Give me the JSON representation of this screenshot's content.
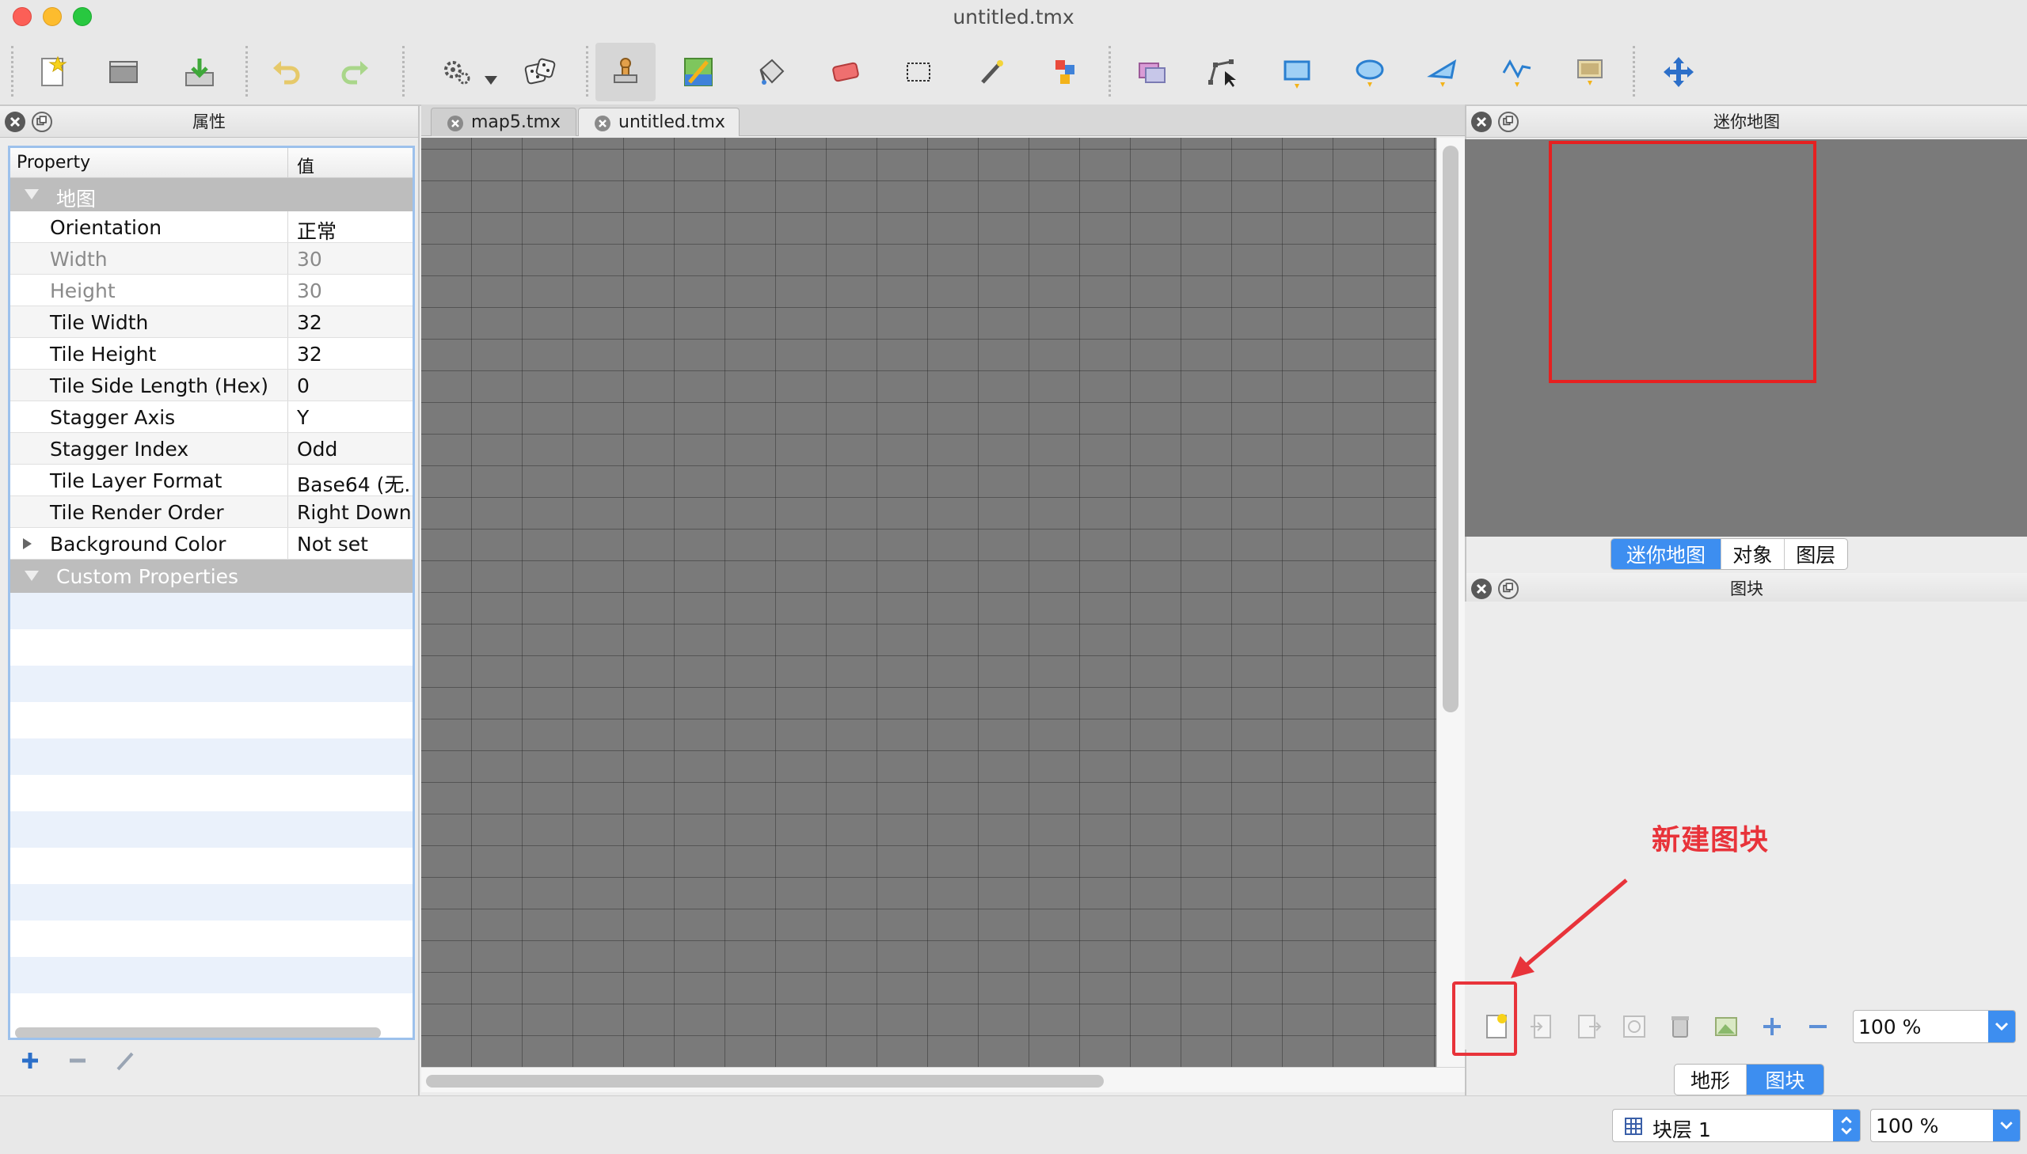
{
  "window": {
    "title": "untitled.tmx"
  },
  "toolbar": {
    "icons": [
      "new-map-icon",
      "open-icon",
      "save-icon",
      "undo-icon",
      "redo-icon",
      "commands-icon",
      "random-mode-icon",
      "stamp-brush-icon",
      "terrain-brush-icon",
      "bucket-fill-icon",
      "eraser-icon",
      "rectangular-select-icon",
      "magic-wand-icon",
      "select-same-tile-icon",
      "select-objects-icon",
      "edit-polygons-icon",
      "insert-rectangle-icon",
      "insert-ellipse-icon",
      "insert-polygon-icon",
      "insert-polyline-icon",
      "insert-tile-icon",
      "move-icon"
    ]
  },
  "properties_panel": {
    "title": "属性",
    "col_property": "Property",
    "col_value": "值",
    "group_map": "地图",
    "rows": [
      {
        "key": "Orientation",
        "value": "正常"
      },
      {
        "key": "Width",
        "value": "30"
      },
      {
        "key": "Height",
        "value": "30"
      },
      {
        "key": "Tile Width",
        "value": "32"
      },
      {
        "key": "Tile Height",
        "value": "32"
      },
      {
        "key": "Tile Side Length (Hex)",
        "value": "0"
      },
      {
        "key": "Stagger Axis",
        "value": "Y"
      },
      {
        "key": "Stagger Index",
        "value": "Odd"
      },
      {
        "key": "Tile Layer Format",
        "value": "Base64 (无..."
      },
      {
        "key": "Tile Render Order",
        "value": "Right Down"
      },
      {
        "key": "Background Color",
        "value": "Not set"
      }
    ],
    "group_custom": "Custom Properties"
  },
  "document_tabs": [
    {
      "label": "map5.tmx"
    },
    {
      "label": "untitled.tmx"
    }
  ],
  "minimap_panel": {
    "title": "迷你地图",
    "tabs": [
      "迷你地图",
      "对象",
      "图层"
    ],
    "active_tab": "迷你地图"
  },
  "tilesets_panel": {
    "title": "图块",
    "zoom": "100 %",
    "tabs": [
      "地形",
      "图块"
    ],
    "active_tab": "图块"
  },
  "annotation": {
    "text": "新建图块",
    "color": "#e8333a"
  },
  "statusbar": {
    "layer": "块层 1",
    "zoom": "100 %"
  },
  "colors": {
    "accent": "#3d8ef0",
    "canvas": "#7a7a7a",
    "annotation_red": "#e8333a"
  }
}
